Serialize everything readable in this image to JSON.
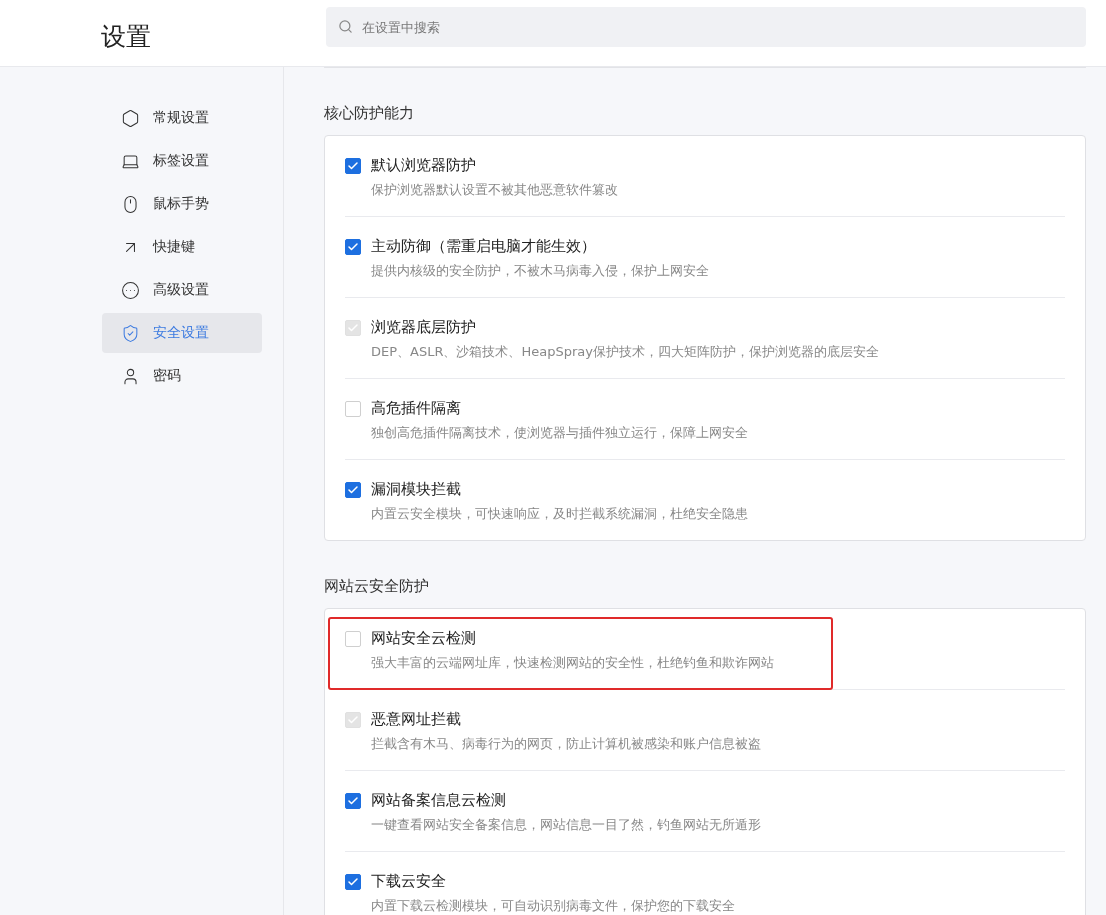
{
  "header": {
    "title": "设置",
    "search": {
      "placeholder": "在设置中搜索"
    }
  },
  "sidebar": {
    "items": [
      {
        "label": "常规设置",
        "selected": false
      },
      {
        "label": "标签设置",
        "selected": false
      },
      {
        "label": "鼠标手势",
        "selected": false
      },
      {
        "label": "快捷键",
        "selected": false
      },
      {
        "label": "高级设置",
        "selected": false
      },
      {
        "label": "安全设置",
        "selected": true
      },
      {
        "label": "密码",
        "selected": false
      }
    ]
  },
  "sections": [
    {
      "title": "核心防护能力",
      "items": [
        {
          "label": "默认浏览器防护",
          "description": "保护浏览器默认设置不被其他恶意软件篡改",
          "checked": true,
          "disabled": false,
          "highlighted": false
        },
        {
          "label": "主动防御（需重启电脑才能生效）",
          "description": "提供内核级的安全防护，不被木马病毒入侵，保护上网安全",
          "checked": true,
          "disabled": false,
          "highlighted": false
        },
        {
          "label": "浏览器底层防护",
          "description": "DEP、ASLR、沙箱技术、HeapSpray保护技术，四大矩阵防护，保护浏览器的底层安全",
          "checked": true,
          "disabled": true,
          "highlighted": false
        },
        {
          "label": "高危插件隔离",
          "description": "独创高危插件隔离技术，使浏览器与插件独立运行，保障上网安全",
          "checked": false,
          "disabled": false,
          "highlighted": false
        },
        {
          "label": "漏洞模块拦截",
          "description": "内置云安全模块，可快速响应，及时拦截系统漏洞，杜绝安全隐患",
          "checked": true,
          "disabled": false,
          "highlighted": false
        }
      ]
    },
    {
      "title": "网站云安全防护",
      "items": [
        {
          "label": "网站安全云检测",
          "description": "强大丰富的云端网址库，快速检测网站的安全性，杜绝钓鱼和欺诈网站",
          "checked": false,
          "disabled": false,
          "highlighted": true
        },
        {
          "label": "恶意网址拦截",
          "description": "拦截含有木马、病毒行为的网页，防止计算机被感染和账户信息被盗",
          "checked": true,
          "disabled": true,
          "highlighted": false
        },
        {
          "label": "网站备案信息云检测",
          "description": "一键查看网站安全备案信息，网站信息一目了然，钓鱼网站无所遁形",
          "checked": true,
          "disabled": false,
          "highlighted": false
        },
        {
          "label": "下载云安全",
          "description": "内置下载云检测模块，可自动识别病毒文件，保护您的下载安全",
          "checked": true,
          "disabled": false,
          "highlighted": false
        }
      ]
    }
  ]
}
